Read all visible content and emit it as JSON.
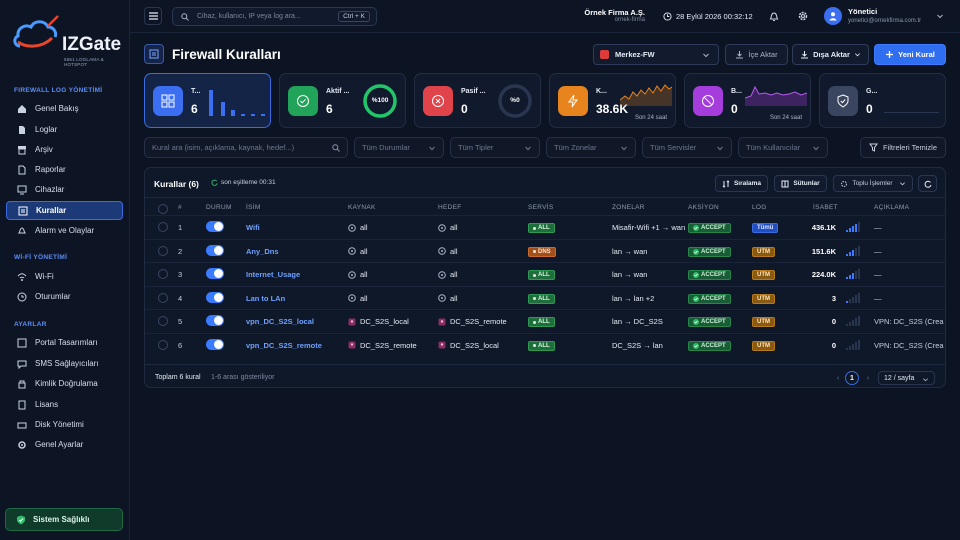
{
  "brand": {
    "name": "IZGate",
    "tagline": "5651 LOGLAMA & HOTSPOT"
  },
  "sidebar": {
    "sections": [
      "FIREWALL LOG YÖNETİMİ",
      "Wİ-Fİ YÖNETİMİ",
      "AYARLAR"
    ],
    "items": [
      "Genel Bakış",
      "Loglar",
      "Arşiv",
      "Raporlar",
      "Cihazlar",
      "Kurallar",
      "Alarm ve Olaylar",
      "Wi-Fi",
      "Oturumlar",
      "Portal Tasarımları",
      "SMS Sağlayıcıları",
      "Kimlik Doğrulama",
      "Lisans",
      "Disk Yönetimi",
      "Genel Ayarlar"
    ],
    "health": "Sistem Sağlıklı"
  },
  "topbar": {
    "search_placeholder": "Cihaz, kullanıcı, IP veya log ara...",
    "shortcut": "Ctrl + K",
    "org_name": "Örnek Firma A.Ş.",
    "org_slug": "ornek-firma",
    "datetime": "28 Eylül 2026 00:32:12",
    "user_name": "Yönetici",
    "user_email": "yonetici@ornekfirma.com.tr"
  },
  "page": {
    "title": "Firewall Kuralları",
    "firewall": "Merkez-FW",
    "import": "İçe Aktar",
    "export": "Dışa Aktar",
    "new_rule": "Yeni Kural"
  },
  "cards": [
    {
      "label": "T...",
      "value": "6",
      "sub": ""
    },
    {
      "label": "Aktif ...",
      "value": "6",
      "ring": "%100",
      "sub": ""
    },
    {
      "label": "Pasif ...",
      "value": "0",
      "ring": "%0",
      "sub": ""
    },
    {
      "label": "K...",
      "value": "38.6K",
      "sub": "Son 24 saat"
    },
    {
      "label": "B...",
      "value": "0",
      "sub": "Son 24 saat"
    },
    {
      "label": "G...",
      "value": "0",
      "sub": ""
    }
  ],
  "filters": {
    "search_placeholder": "Kural ara (isim, açıklama, kaynak, hedef...)",
    "status": "Tüm Durumlar",
    "type": "Tüm Tipler",
    "zone": "Tüm Zonelar",
    "service": "Tüm Servisler",
    "user": "Tüm Kullanıcılar",
    "clear": "Filtreleri Temizle"
  },
  "table": {
    "title": "Kurallar (6)",
    "sync": "son eşitleme 00:31",
    "sort": "Sıralama",
    "columns": "Sütunlar",
    "bulk": "Toplu İşlemler",
    "headers": [
      "#",
      "DURUM",
      "İSİM",
      "KAYNAK",
      "HEDEF",
      "SERVİS",
      "ZONELAR",
      "AKSİYON",
      "LOG",
      "İSABET",
      "AÇIKLAMA"
    ],
    "rows": [
      {
        "n": "1",
        "name": "Wifi",
        "src": "all",
        "dst": "all",
        "svc": "ALL",
        "zone": "Misafir-Wifi +1 → wan",
        "action": "ACCEPT",
        "log": "Tümü",
        "hits": "436.1K",
        "desc": "—"
      },
      {
        "n": "2",
        "name": "Any_Dns",
        "src": "all",
        "dst": "all",
        "svc": "DNS",
        "zone": "lan → wan",
        "action": "ACCEPT",
        "log": "UTM",
        "hits": "151.6K",
        "desc": "—"
      },
      {
        "n": "3",
        "name": "Internet_Usage",
        "src": "all",
        "dst": "all",
        "svc": "ALL",
        "zone": "lan → wan",
        "action": "ACCEPT",
        "log": "UTM",
        "hits": "224.0K",
        "desc": "—"
      },
      {
        "n": "4",
        "name": "Lan to LAn",
        "src": "all",
        "dst": "all",
        "svc": "ALL",
        "zone": "lan → lan +2",
        "action": "ACCEPT",
        "log": "UTM",
        "hits": "3",
        "desc": "—"
      },
      {
        "n": "5",
        "name": "vpn_DC_S2S_local",
        "src": "DC_S2S_local",
        "dst": "DC_S2S_remote",
        "svc": "ALL",
        "zone": "lan → DC_S2S",
        "action": "ACCEPT",
        "log": "UTM",
        "hits": "0",
        "desc": "VPN: DC_S2S (Crea"
      },
      {
        "n": "6",
        "name": "vpn_DC_S2S_remote",
        "src": "DC_S2S_remote",
        "dst": "DC_S2S_local",
        "svc": "ALL",
        "zone": "DC_S2S → lan",
        "action": "ACCEPT",
        "log": "UTM",
        "hits": "0",
        "desc": "VPN: DC_S2S (Crea"
      }
    ],
    "footer_total": "Toplam 6 kural",
    "footer_range": "1-6 arası gösteriliyor",
    "page": "1",
    "per_page": "12 / sayfa"
  }
}
